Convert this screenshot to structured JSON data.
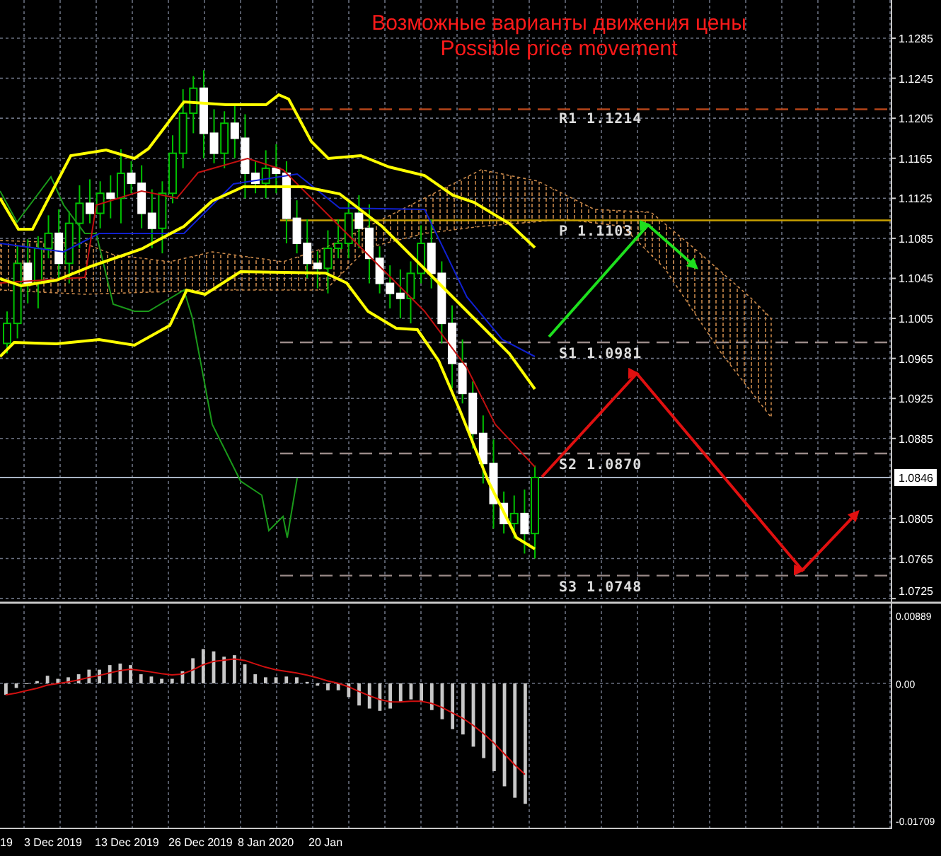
{
  "title": {
    "lines": [
      "Возможные варианты движения цены",
      "Possible price movement"
    ]
  },
  "price_axis": {
    "labels": [
      "1.1285",
      "1.1245",
      "1.1205",
      "1.1165",
      "1.1125",
      "1.1085",
      "1.1045",
      "1.1005",
      "1.0965",
      "1.0925",
      "1.0885",
      "1.0805",
      "1.0765",
      "1.0725"
    ],
    "current_price": "1.0846"
  },
  "levels": [
    {
      "label": "R1 1.1214",
      "kind": "resistance"
    },
    {
      "label": "P 1.1103",
      "kind": "pivot"
    },
    {
      "label": "S1 1.0981",
      "kind": "support"
    },
    {
      "label": "S2 1.0870",
      "kind": "support"
    },
    {
      "label": "S3 1.0748",
      "kind": "support"
    }
  ],
  "indicator_axis": {
    "labels": [
      "0.00889",
      "0.00",
      "-0.01709"
    ]
  },
  "time_axis": {
    "labels": [
      "19",
      "3 Dec 2019",
      "13 Dec 2019",
      "26 Dec 2019",
      "8 Jan 2020",
      "20 Jan"
    ]
  }
}
